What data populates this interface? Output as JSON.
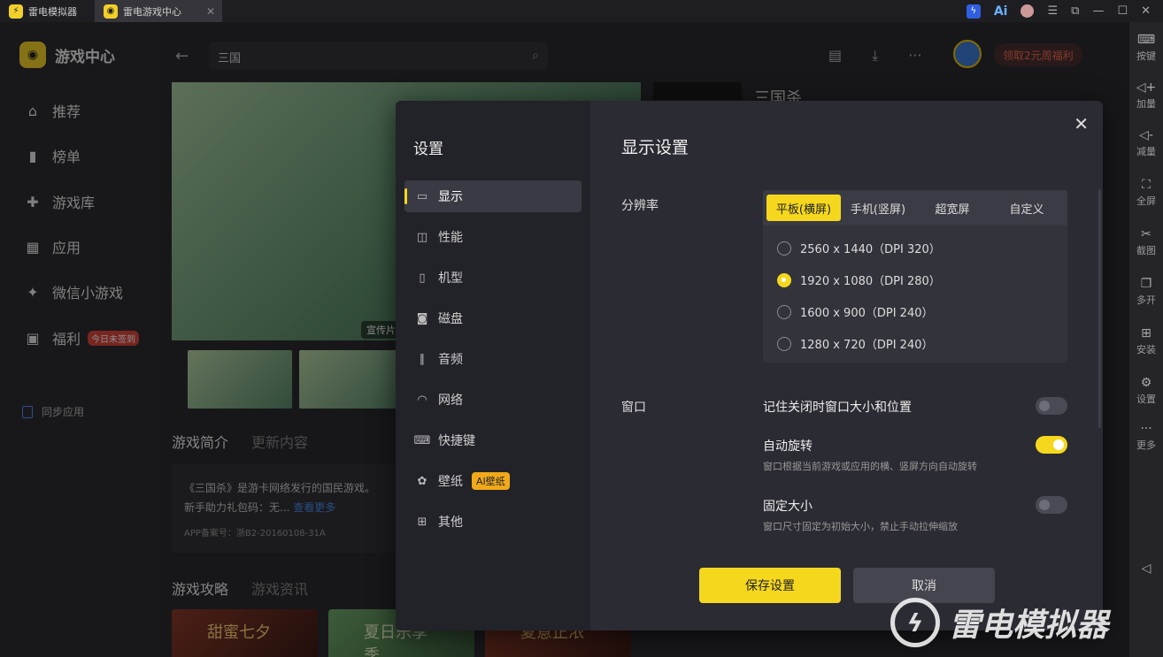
{
  "titlebar": {
    "tab1": "雷电模拟器",
    "tab2": "雷电游戏中心",
    "close": "✕",
    "ai_label": "Ai"
  },
  "sidebar": {
    "brand": "游戏中心",
    "items": [
      {
        "label": "推荐",
        "icon": "home-icon"
      },
      {
        "label": "榜单",
        "icon": "chart-icon"
      },
      {
        "label": "游戏库",
        "icon": "gamepad-icon"
      },
      {
        "label": "应用",
        "icon": "apps-icon"
      },
      {
        "label": "微信小游戏",
        "icon": "wechat-game-icon"
      },
      {
        "label": "福利",
        "icon": "gift-icon",
        "badge": "今日未签到"
      }
    ],
    "sync": "同步应用"
  },
  "main": {
    "search_value": "三国",
    "reward": "领取2元周福利",
    "banner_label": "宣传片",
    "game_title": "三国杀",
    "tabs": [
      "游戏简介",
      "更新内容"
    ],
    "desc": "《三国杀》是游卡网络发行的国民游戏。",
    "desc2": "新手助力礼包码：无...",
    "desc_link": "查看更多",
    "app_record": "APP备案号：浙B2-20160108-31A",
    "guide_tabs": [
      "游戏攻略",
      "游戏资讯"
    ],
    "cards": [
      "甜蜜七夕",
      "夏日乐享季",
      "夏意正浓"
    ]
  },
  "rtool": {
    "items": [
      "按键",
      "加量",
      "减量",
      "全屏",
      "截图",
      "多开",
      "安装",
      "设置",
      "更多"
    ]
  },
  "dialog": {
    "side_title": "设置",
    "side_items": [
      {
        "label": "显示",
        "icon": "monitor-icon"
      },
      {
        "label": "性能",
        "icon": "performance-icon"
      },
      {
        "label": "机型",
        "icon": "phone-icon"
      },
      {
        "label": "磁盘",
        "icon": "disk-icon"
      },
      {
        "label": "音频",
        "icon": "audio-icon"
      },
      {
        "label": "网络",
        "icon": "wifi-icon"
      },
      {
        "label": "快捷键",
        "icon": "keyboard-icon"
      },
      {
        "label": "壁纸",
        "icon": "palette-icon",
        "badge": "AI壁纸"
      },
      {
        "label": "其他",
        "icon": "grid-icon"
      }
    ],
    "title": "显示设置",
    "resolution_label": "分辨率",
    "res_tabs": [
      "平板(横屏)",
      "手机(竖屏)",
      "超宽屏",
      "自定义"
    ],
    "res_options": [
      "2560 x 1440（DPI 320）",
      "1920 x 1080（DPI 280）",
      "1600 x 900（DPI 240）",
      "1280 x 720（DPI 240）"
    ],
    "selected_option": 1,
    "window_label": "窗口",
    "options": [
      {
        "title": "记住关闭时窗口大小和位置",
        "desc": "",
        "on": false
      },
      {
        "title": "自动旋转",
        "desc": "窗口根据当前游戏或应用的横、竖屏方向自动旋转",
        "on": true
      },
      {
        "title": "固定大小",
        "desc": "窗口尺寸固定为初始大小，禁止手动拉伸缩放",
        "on": false
      }
    ],
    "save": "保存设置",
    "cancel": "取消"
  },
  "watermark": "雷电模拟器",
  "colors": {
    "accent": "#f5d81d",
    "link": "#4a8cf0",
    "badge": "#d9463b"
  }
}
